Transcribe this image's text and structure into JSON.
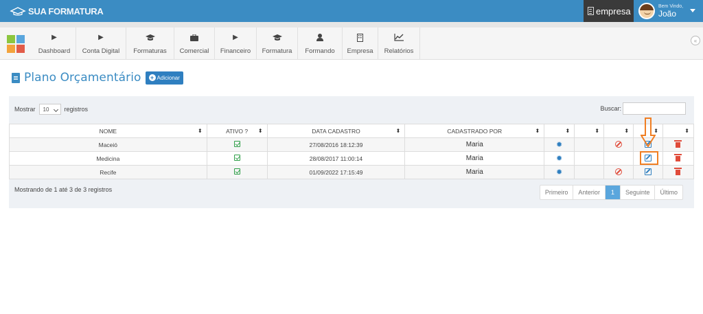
{
  "app": {
    "logo_text": "SUA FORMATURA",
    "empresa_label": "empresa",
    "welcome": "Bem Vindo,",
    "user_name": "João"
  },
  "nav": {
    "items": [
      {
        "label": "Dashboard",
        "icon": "play-icon"
      },
      {
        "label": "Conta Digital",
        "icon": "play-icon"
      },
      {
        "label": "Formaturas",
        "icon": "graduation-cap-icon"
      },
      {
        "label": "Comercial",
        "icon": "briefcase-icon"
      },
      {
        "label": "Financeiro",
        "icon": "play-icon"
      },
      {
        "label": "Formatura",
        "icon": "graduation-cap-icon"
      },
      {
        "label": "Formando",
        "icon": "user-icon"
      },
      {
        "label": "Empresa",
        "icon": "building-icon"
      },
      {
        "label": "Relatórios",
        "icon": "line-chart-icon"
      }
    ]
  },
  "page": {
    "title": "Plano Orçamentário",
    "add_label": "Adicionar"
  },
  "table_controls": {
    "show_prefix": "Mostrar",
    "page_length": "10",
    "show_suffix": "registros",
    "search_label": "Buscar:",
    "search_value": ""
  },
  "table": {
    "columns": [
      "NOME",
      "ATIVO ?",
      "DATA CADASTRO",
      "CADASTRADO POR",
      "",
      "",
      "",
      "",
      ""
    ],
    "rows": [
      {
        "nome": "Maceió",
        "ativo": true,
        "data": "27/08/2016 18:12:39",
        "por": "Maria"
      },
      {
        "nome": "Medicina",
        "ativo": true,
        "data": "28/08/2017 11:00:14",
        "por": "Maria"
      },
      {
        "nome": "Recife",
        "ativo": true,
        "data": "01/09/2022 17:15:49",
        "por": "Maria"
      }
    ]
  },
  "footer": {
    "info": "Mostrando de 1 até 3 de 3 registros",
    "pager": {
      "first": "Primeiro",
      "prev": "Anterior",
      "current": "1",
      "next": "Seguinte",
      "last": "Último"
    }
  },
  "colors": {
    "topbar": "#3b8cc3",
    "accent": "#2f7fc0",
    "highlight": "#f07e22",
    "success": "#2e9e47",
    "danger": "#e04b3a"
  }
}
